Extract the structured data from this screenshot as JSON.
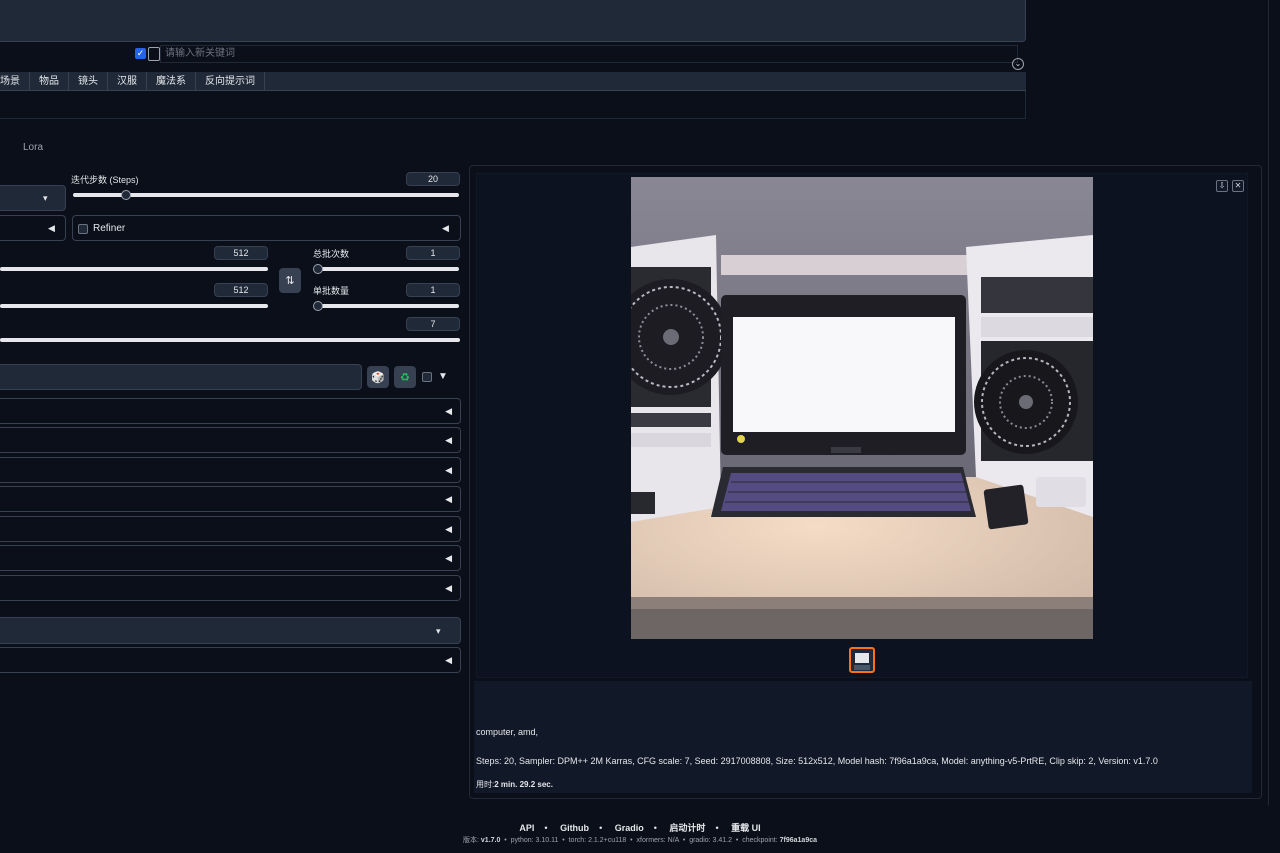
{
  "keyword_input": {
    "placeholder": "请输入新关键词"
  },
  "tag_tabs": [
    "场景",
    "物品",
    "镜头",
    "汉服",
    "魔法系",
    "反向提示词"
  ],
  "tabs": {
    "lora": "Lora"
  },
  "steps": {
    "label": "迭代步数 (Steps)",
    "value": "20",
    "fraction": 0.13
  },
  "refiner": {
    "label": "Refiner"
  },
  "width": {
    "value": "512"
  },
  "height": {
    "value": "512"
  },
  "batch_count": {
    "label": "总批次数",
    "value": "1"
  },
  "batch_size": {
    "label": "单批数量",
    "value": "1"
  },
  "cfg": {
    "value": "7"
  },
  "swap_icon": "swap-icon",
  "output": {
    "prompt": "computer, amd,",
    "params": "Steps: 20, Sampler: DPM++ 2M Karras, CFG scale: 7, Seed: 2917008808, Size: 512x512, Model hash: 7f96a1a9ca, Model: anything-v5-PrtRE, Clip skip: 2, Version: v1.7.0",
    "time_label": "用时:",
    "time_value": "2 min. 29.2 sec."
  },
  "footer": {
    "links": [
      "API",
      "Github",
      "Gradio",
      "启动计时",
      "重载 UI"
    ],
    "version_label": "版本:",
    "version": "v1.7.0",
    "python_label": "python:",
    "python": "3.10.11",
    "torch_label": "torch:",
    "torch": "2.1.2+cu118",
    "xformers_label": "xformers:",
    "xformers": "N/A",
    "gradio_label": "gradio:",
    "gradio": "3.41.2",
    "checkpoint_label": "checkpoint:",
    "checkpoint": "7f96a1a9ca"
  },
  "colors": {
    "accent": "#2563eb",
    "thumb_border": "#f97316",
    "bg": "#0b0f19"
  }
}
